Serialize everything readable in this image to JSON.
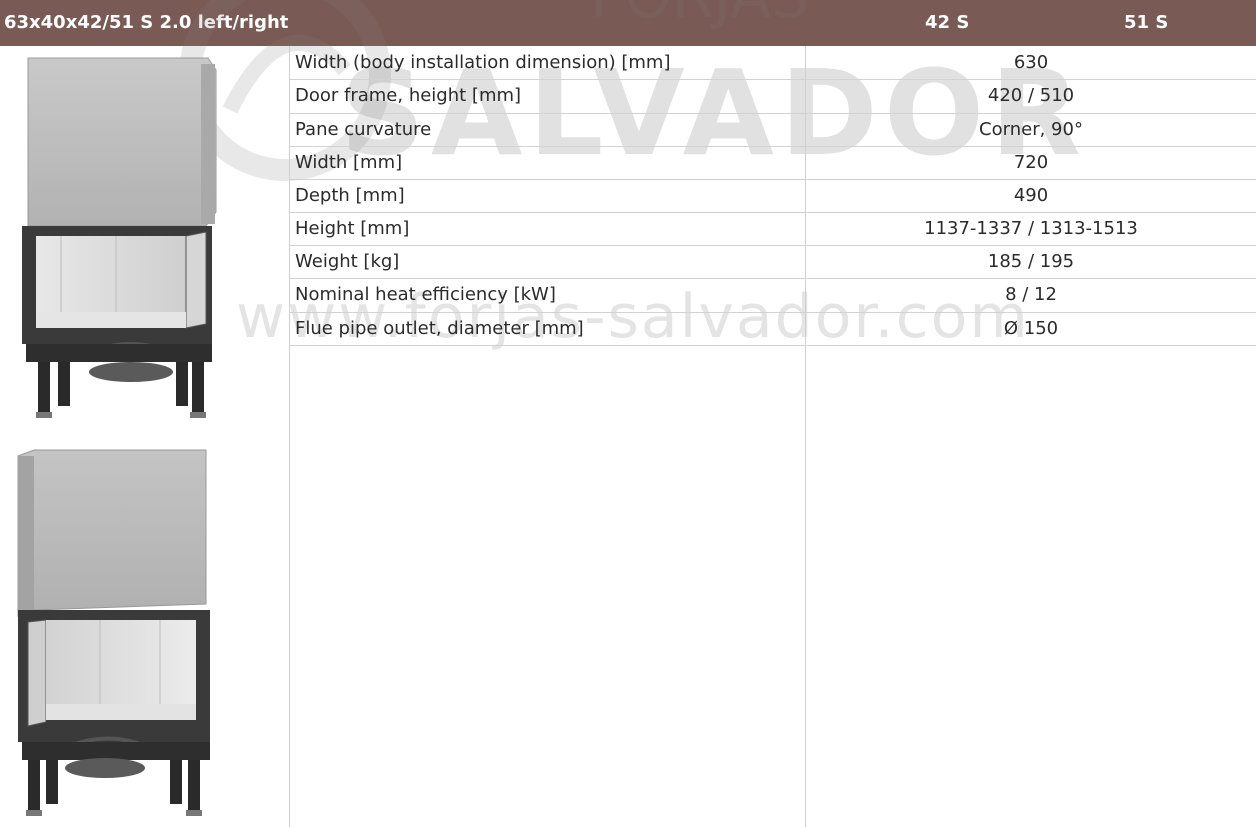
{
  "header": {
    "title": "63x40x42/51 S 2.0 left/right",
    "col1": "42 S",
    "col2": "51 S"
  },
  "specs": [
    {
      "label": "Width (body installation dimension) [mm]",
      "value": "630"
    },
    {
      "label": "Door frame, height [mm]",
      "value": "420 / 510"
    },
    {
      "label": "Pane curvature",
      "value": "Corner, 90°"
    },
    {
      "label": "Width [mm]",
      "value": "720"
    },
    {
      "label": "Depth [mm]",
      "value": "490"
    },
    {
      "label": "Height [mm]",
      "value": "1137-1337 / 1313-1513"
    },
    {
      "label": "Weight [kg]",
      "value": "185 / 195"
    },
    {
      "label": "Nominal heat efficiency [kW]",
      "value": "8 / 12"
    },
    {
      "label": "Flue pipe outlet, diameter [mm]",
      "value": "Ø 150"
    }
  ],
  "watermark": {
    "brand": "SALVADOR",
    "url": "www.forjas-salvador.com",
    "top": "FORJAS"
  },
  "colors": {
    "header_bg": "#7a5a55",
    "header_text": "#ffffff",
    "grid_line": "#cfcfcf"
  }
}
